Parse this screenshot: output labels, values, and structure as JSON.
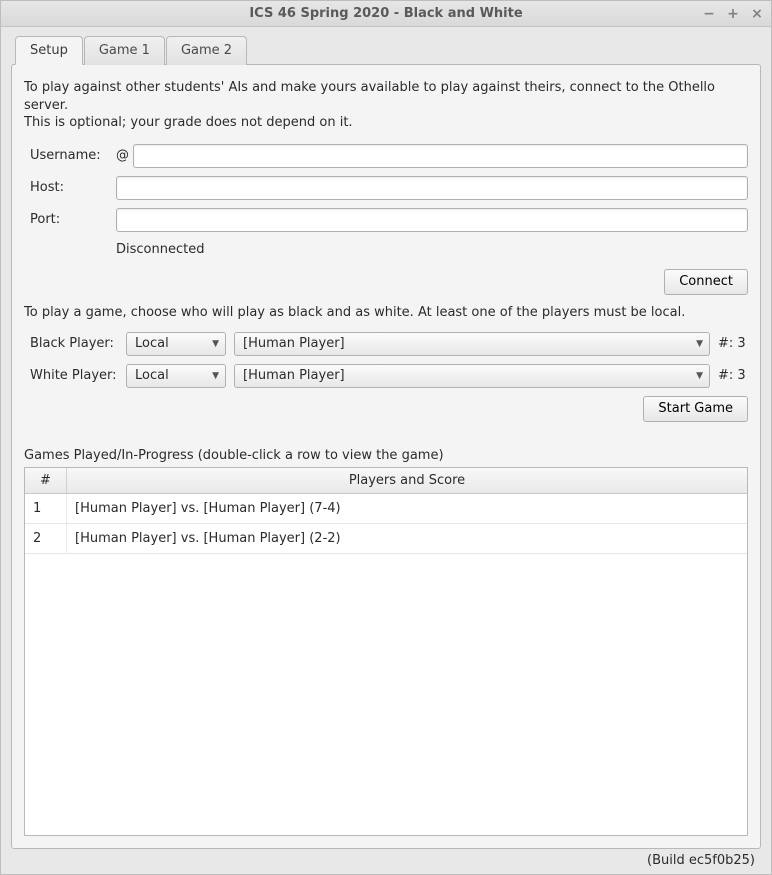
{
  "window": {
    "title": "ICS 46 Spring 2020 - Black and White"
  },
  "tabs": [
    {
      "label": "Setup"
    },
    {
      "label": "Game 1"
    },
    {
      "label": "Game 2"
    }
  ],
  "intro": {
    "line1": "To play against other students' AIs and make yours available to play against theirs, connect to the Othello server.",
    "line2": "This is optional; your grade does not depend on it."
  },
  "connection": {
    "username_label": "Username:",
    "username_prefix": "@",
    "username_value": "",
    "host_label": "Host:",
    "host_value": "",
    "port_label": "Port:",
    "port_value": "",
    "status": "Disconnected",
    "connect_button": "Connect"
  },
  "player_section": {
    "instruction": "To play a game, choose who will play as black and as white.  At least one of the players must be local.",
    "black_label": "Black Player:",
    "black_location": "Local",
    "black_player": "[Human Player]",
    "black_count": "#: 3",
    "white_label": "White Player:",
    "white_location": "Local",
    "white_player": "[Human Player]",
    "white_count": "#: 3",
    "start_button": "Start Game"
  },
  "games_table": {
    "caption": "Games Played/In-Progress (double-click a row to view the game)",
    "col_num": "#",
    "col_players": "Players and Score",
    "rows": [
      {
        "num": "1",
        "desc": "[Human Player] vs. [Human Player] (7-4)"
      },
      {
        "num": "2",
        "desc": "[Human Player] vs. [Human Player] (2-2)"
      }
    ]
  },
  "footer": {
    "build": "(Build ec5f0b25)"
  }
}
